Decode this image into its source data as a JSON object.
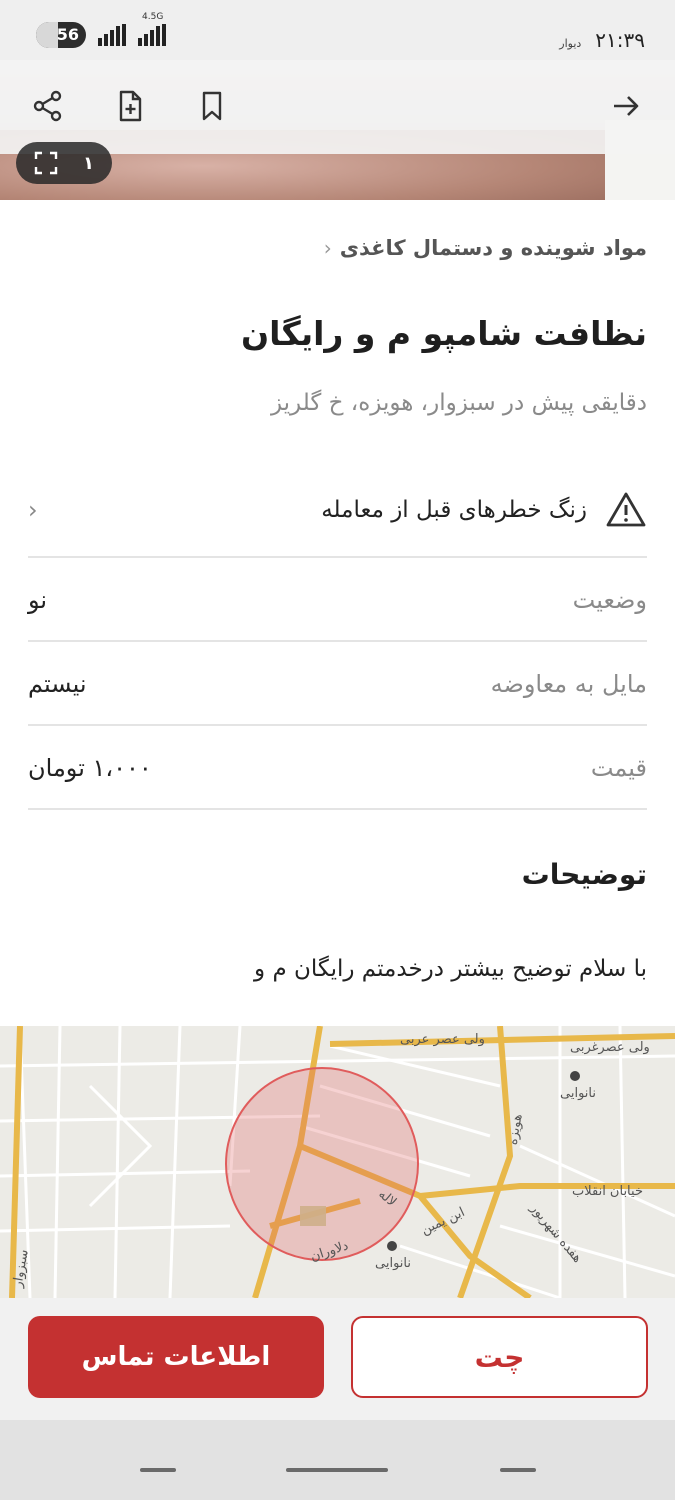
{
  "status_bar": {
    "time": "۲۱:۳۹",
    "app_name": "دیوار",
    "battery_level": "56",
    "network_label": "4.5G"
  },
  "toolbar": {
    "icons": [
      "share-icon",
      "add-note-icon",
      "bookmark-icon",
      "back-arrow-icon"
    ]
  },
  "gallery": {
    "count": "۱"
  },
  "breadcrumb": {
    "category": "مواد شوینده و دستمال کاغذی"
  },
  "listing": {
    "title": "نظافت شامپو م و رایگان",
    "subtitle": "دقایقی پیش در سبزوار، هویزه، خ گلریز"
  },
  "warning": {
    "label": "زنگ خطرهای قبل از معامله"
  },
  "details": [
    {
      "key": "وضعیت",
      "value": "نو"
    },
    {
      "key": "مایل به معاوضه",
      "value": "نیستم"
    },
    {
      "key": "قیمت",
      "value": "۱،۰۰۰ تومان"
    }
  ],
  "description": {
    "title": "توضیحات",
    "text": "با سلام توضیح بیشتر درخدمتم رایگان م و"
  },
  "map": {
    "labels": {
      "vali_asr_1": "ولی عصر عربی",
      "vali_asr_2": "ولی عصرغربی",
      "bakery_1": "نانوایی",
      "bakery_2": "نانوایی",
      "enghelab": "خیابان انقلاب",
      "dolavaran": "دلاوران",
      "bahman": "ابن یمین",
      "hoveyzeh": "هویزه",
      "lale": "لاله",
      "hefdah": "هفده شهریور",
      "sabzevar": "سبزوار"
    },
    "accent": "#e05c5c"
  },
  "actions": {
    "contact_label": "اطلاعات تماس",
    "chat_label": "چت"
  },
  "colors": {
    "brand": "#c43131"
  }
}
